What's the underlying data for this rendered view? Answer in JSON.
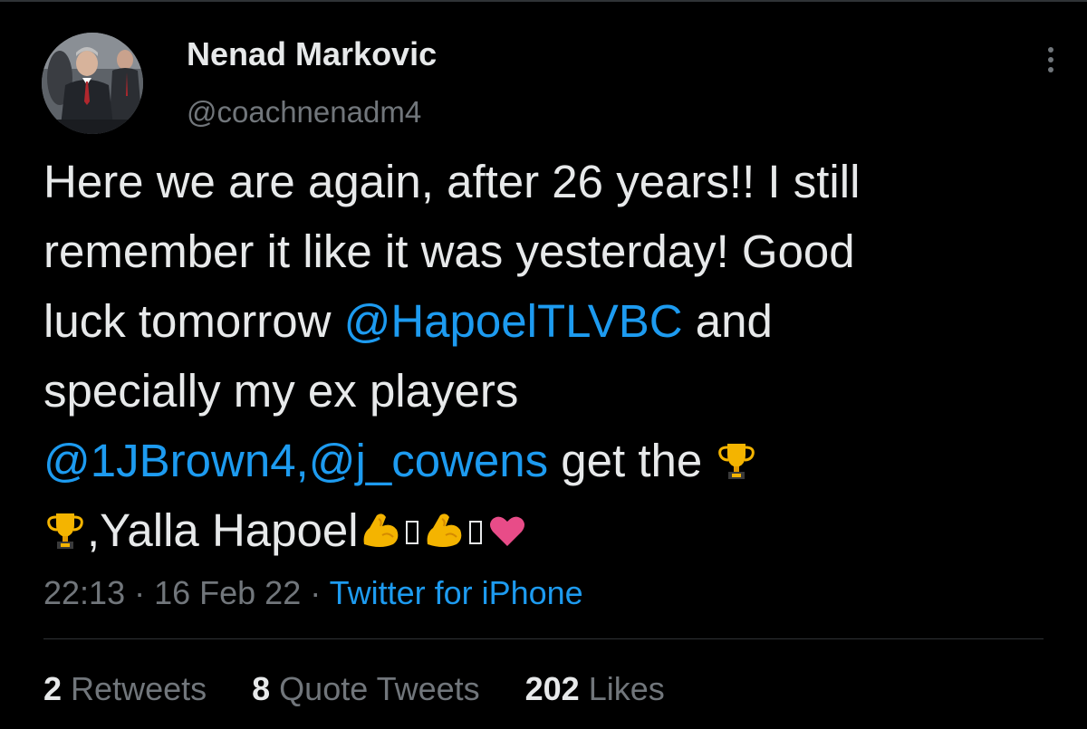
{
  "colors": {
    "background": "#000000",
    "text": "#e7e9ea",
    "secondary": "#71767b",
    "link": "#1d9bf0",
    "divider": "#2f3336"
  },
  "author": {
    "name": "Nenad Markovic",
    "handle": "@coachnenadm4"
  },
  "tweet": {
    "line1": "Here we are again, after 26 years!! I still",
    "line2": "remember it like it was yesterday! Good",
    "line3_pre": "luck tomorrow ",
    "line3_mention": "@HapoelTLVBC",
    "line3_post": " and",
    "line4": "specially my ex players",
    "line5_mention": "@1JBrown4,@j_cowens",
    "line5_post": " get the ",
    "line6_text": ",Yalla Hapoel",
    "emoji_trophy": "trophy-emoji",
    "emoji_muscle": "flexed-biceps-emoji",
    "emoji_heart": "heart-emoji"
  },
  "meta": {
    "time": "22:13",
    "separator": " · ",
    "date": "16 Feb 22",
    "source": "Twitter for iPhone"
  },
  "stats": {
    "retweets_count": "2",
    "retweets_label": "Retweets",
    "quotes_count": "8",
    "quotes_label": "Quote Tweets",
    "likes_count": "202",
    "likes_label": "Likes"
  }
}
